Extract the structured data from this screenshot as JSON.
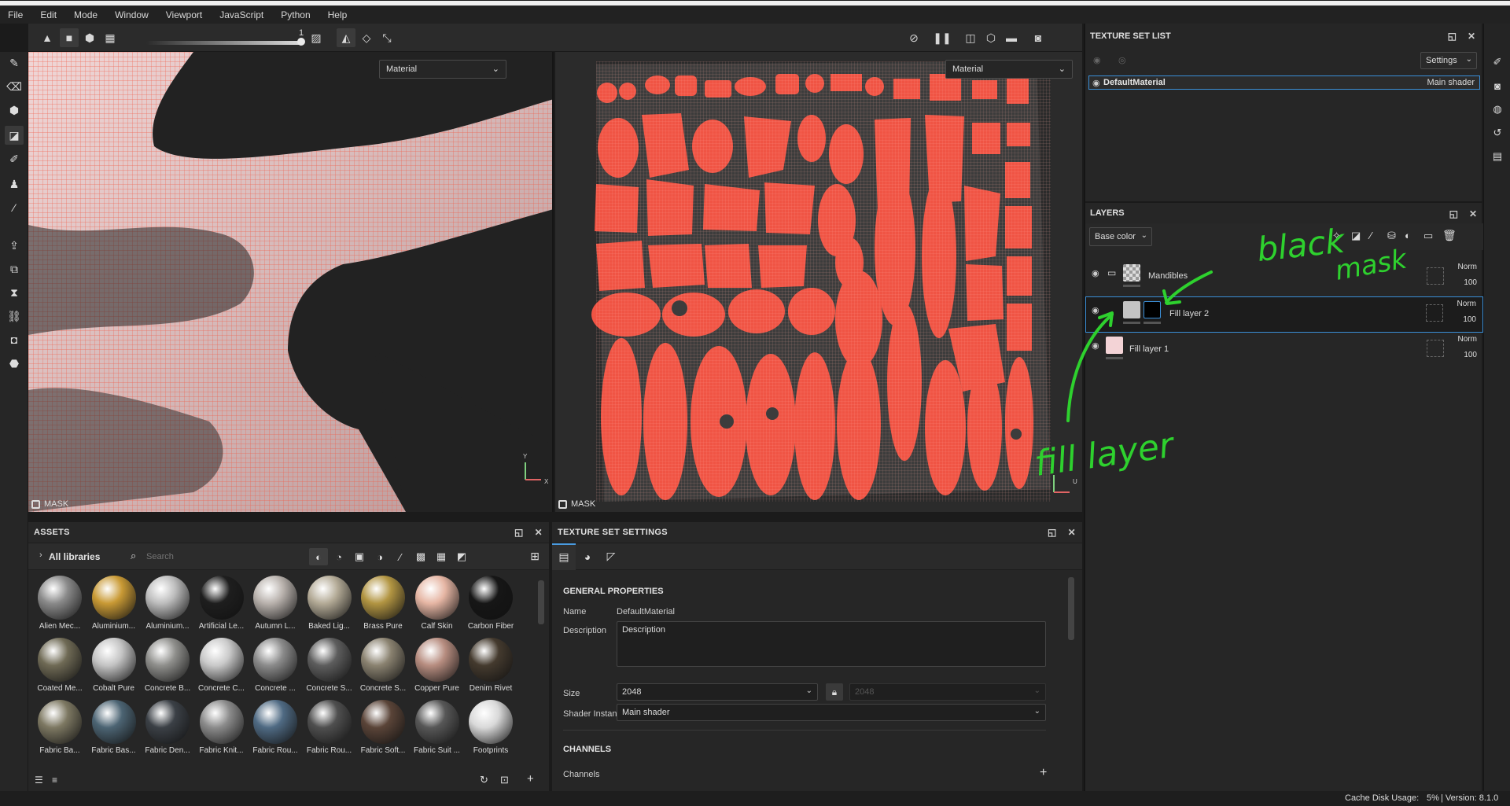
{
  "menu": [
    "File",
    "Edit",
    "Mode",
    "Window",
    "Viewport",
    "JavaScript",
    "Python",
    "Help"
  ],
  "toolbar": {
    "slider_value": "1"
  },
  "viewport3d": {
    "mode": "Material",
    "mask_label": "MASK",
    "axis_y": "Y",
    "axis_x": "X"
  },
  "viewport2d": {
    "mode": "Material",
    "mask_label": "MASK",
    "axis_u": "U"
  },
  "assets": {
    "title": "ASSETS",
    "library": "All libraries",
    "search_placeholder": "Search",
    "items": [
      {
        "name": "Alien Mec...",
        "color": "#8a8a8a"
      },
      {
        "name": "Aluminium...",
        "color": "#c99a35"
      },
      {
        "name": "Aluminium...",
        "color": "#bdbdbd"
      },
      {
        "name": "Artificial Le...",
        "color": "#1e1e1e"
      },
      {
        "name": "Autumn L...",
        "color": "#b9b2ad"
      },
      {
        "name": "Baked Lig...",
        "color": "#b4ab97"
      },
      {
        "name": "Brass Pure",
        "color": "#b29542"
      },
      {
        "name": "Calf Skin",
        "color": "#e6b6a4"
      },
      {
        "name": "Carbon Fiber",
        "color": "#161616"
      },
      {
        "name": "Coated Me...",
        "color": "#6f6a55"
      },
      {
        "name": "Cobalt Pure",
        "color": "#c4c4c4"
      },
      {
        "name": "Concrete B...",
        "color": "#8f8f8c"
      },
      {
        "name": "Concrete C...",
        "color": "#c9c9c9"
      },
      {
        "name": "Concrete ...",
        "color": "#8b8b8b"
      },
      {
        "name": "Concrete S...",
        "color": "#5d5d5d"
      },
      {
        "name": "Concrete S...",
        "color": "#8a8270"
      },
      {
        "name": "Copper Pure",
        "color": "#b78d80"
      },
      {
        "name": "Denim Rivet",
        "color": "#443a2e"
      },
      {
        "name": "Fabric Ba...",
        "color": "#7d7862"
      },
      {
        "name": "Fabric Bas...",
        "color": "#4c6473"
      },
      {
        "name": "Fabric Den...",
        "color": "#3b4046"
      },
      {
        "name": "Fabric Knit...",
        "color": "#8b8b8b"
      },
      {
        "name": "Fabric Rou...",
        "color": "#4f6a83"
      },
      {
        "name": "Fabric Rou...",
        "color": "#4f4f4f"
      },
      {
        "name": "Fabric Soft...",
        "color": "#5a4438"
      },
      {
        "name": "Fabric Suit ...",
        "color": "#575757"
      },
      {
        "name": "Footprints",
        "color": "#d9d9d9"
      }
    ]
  },
  "tss": {
    "title": "TEXTURE SET SETTINGS",
    "general": "GENERAL PROPERTIES",
    "name_label": "Name",
    "name_value": "DefaultMaterial",
    "desc_label": "Description",
    "desc_value": "Description",
    "size_label": "Size",
    "size_value": "2048",
    "size_locked_value": "2048",
    "shader_label": "Shader Instance",
    "shader_value": "Main shader",
    "channels_title": "CHANNELS",
    "channels_label": "Channels"
  },
  "tsl": {
    "title": "TEXTURE SET LIST",
    "settings": "Settings",
    "material": "DefaultMaterial",
    "shader": "Main shader"
  },
  "layers": {
    "title": "LAYERS",
    "channel": "Base color",
    "rows": [
      {
        "name": "Mandibles",
        "blend": "Norm",
        "opacity": "100"
      },
      {
        "name": "Fill layer 2",
        "blend": "Norm",
        "opacity": "100"
      },
      {
        "name": "Fill layer 1",
        "blend": "Norm",
        "opacity": "100"
      }
    ]
  },
  "annotations": {
    "black_mask_1": "black",
    "black_mask_2": "mask",
    "fill_layer": "fill layer"
  },
  "status": {
    "cache_label": "Cache Disk Usage:",
    "cache_value": "5%",
    "version": "| Version: 8.1.0"
  }
}
